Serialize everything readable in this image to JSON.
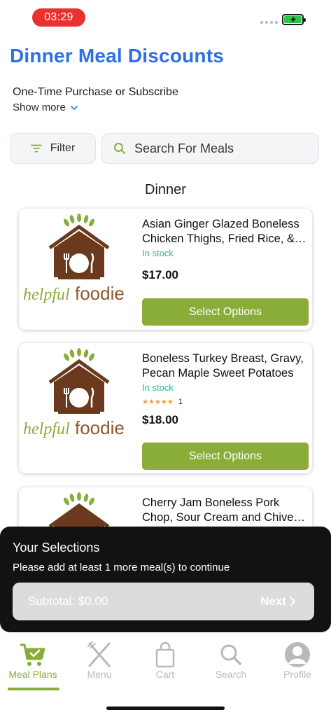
{
  "status_bar": {
    "time": "03:29",
    "battery_color": "#31c048"
  },
  "header": {
    "title": "Dinner Meal Discounts",
    "subtitle": "One-Time Purchase or Subscribe",
    "show_more": "Show more"
  },
  "filters": {
    "filter_label": "Filter",
    "search_placeholder": "Search For Meals"
  },
  "section": {
    "title": "Dinner"
  },
  "brand": {
    "name_left": "helpful",
    "name_right": "foodie",
    "accent": "#8aad3a",
    "barn": "#6b3a1e"
  },
  "products": [
    {
      "name": "Asian Ginger Glazed Boneless Chicken Thighs, Fried Rice, & Chili Glazed Broccoli",
      "stock": "In stock",
      "price": "$17.00",
      "button": "Select Options"
    },
    {
      "name": "Boneless Turkey Breast, Gravy, Pecan Maple Sweet Potatoes",
      "stock": "In stock",
      "rating_stars": 5,
      "rating_count": "1",
      "price": "$18.00",
      "button": "Select Options"
    },
    {
      "name": "Cherry Jam Boneless Pork Chop, Sour Cream and Chive Mashed Potatoes"
    }
  ],
  "selections": {
    "title": "Your Selections",
    "message": "Please add at least 1 more meal(s) to continue",
    "subtotal_label": "Subtotal:",
    "subtotal_value": "$0.00",
    "next_label": "Next"
  },
  "nav": {
    "items": [
      {
        "label": "Meal Plans",
        "icon": "cart-check-icon",
        "active": true
      },
      {
        "label": "Menu",
        "icon": "fork-knife-icon",
        "active": false
      },
      {
        "label": "Cart",
        "icon": "bag-icon",
        "active": false
      },
      {
        "label": "Search",
        "icon": "search-icon",
        "active": false
      },
      {
        "label": "Profile",
        "icon": "profile-icon",
        "active": false
      }
    ]
  }
}
